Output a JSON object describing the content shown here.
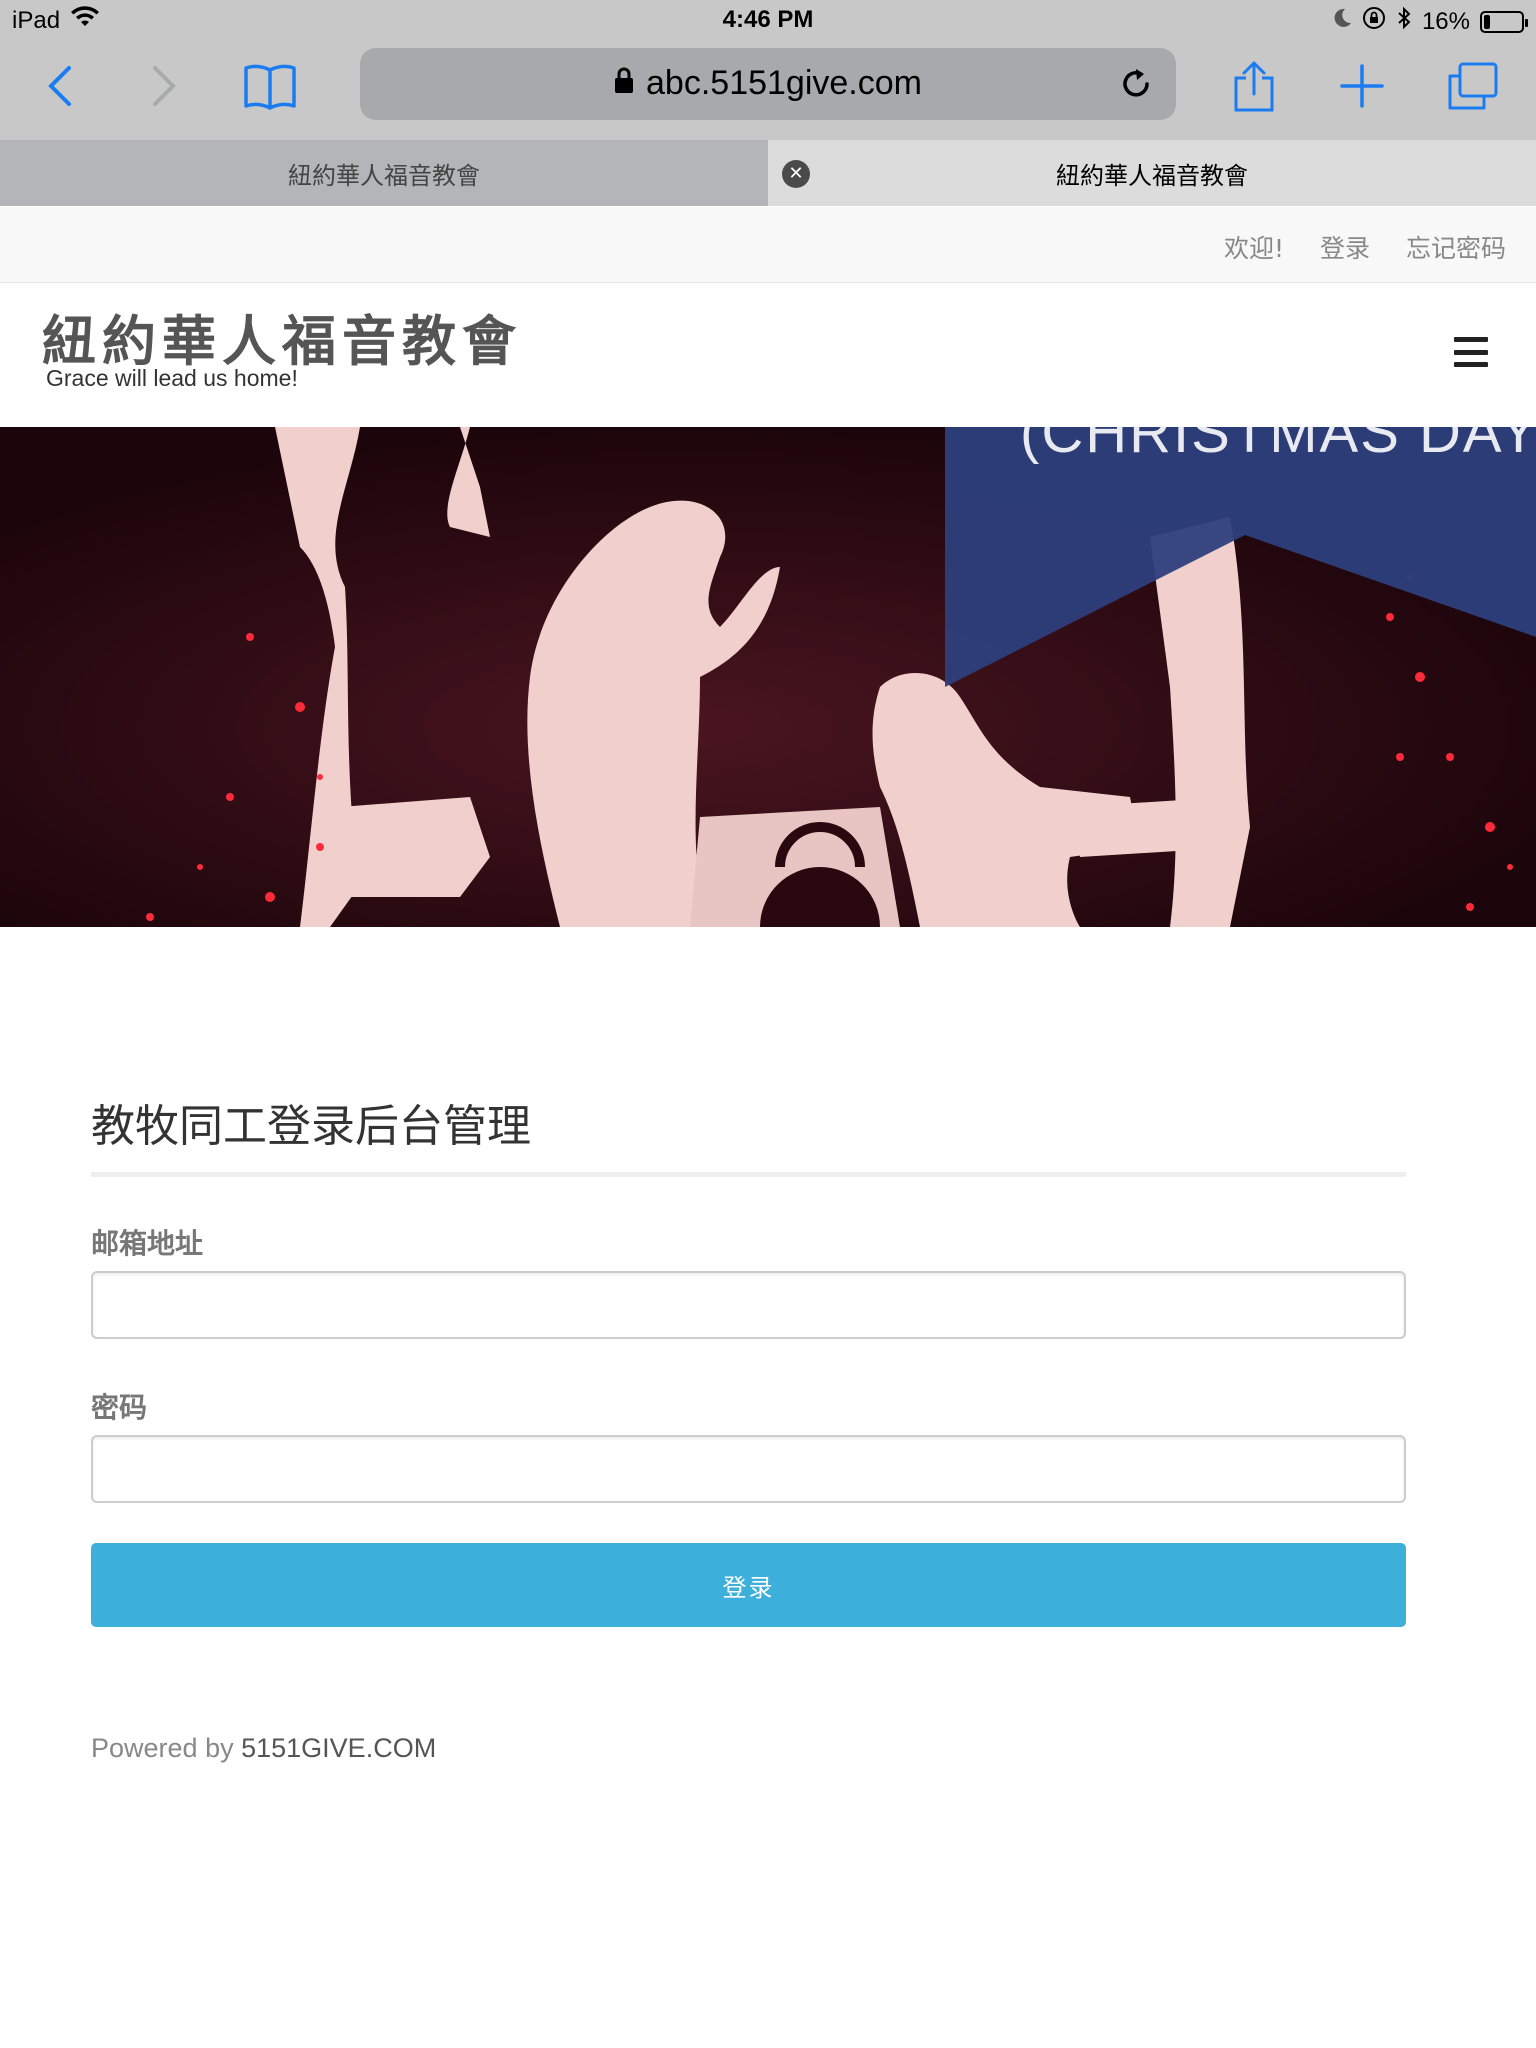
{
  "status_bar": {
    "device": "iPad",
    "time": "4:46 PM",
    "battery_percent": "16%",
    "battery_level": 0.16
  },
  "browser": {
    "url": "abc.5151give.com",
    "tabs": [
      {
        "title": "紐約華人福音教會"
      },
      {
        "title": "紐約華人福音教會"
      }
    ]
  },
  "topbar": {
    "welcome": "欢迎!",
    "login_link": "登录",
    "forgot_link": "忘记密码"
  },
  "header": {
    "site_title": "紐約華人福音教會",
    "tagline": "Grace will lead us home!"
  },
  "hero": {
    "caption": "(CHRISTMAS DAY)"
  },
  "form": {
    "title": "教牧同工登录后台管理",
    "email_label": "邮箱地址",
    "email_value": "",
    "password_label": "密码",
    "password_value": "",
    "submit_label": "登录"
  },
  "footer": {
    "powered_prefix": "Powered by",
    "powered_link": "5151GIVE.COM"
  },
  "colors": {
    "accent": "#3cafda",
    "hero_banner": "#2d3f7c",
    "hero_bg": "#2a0810",
    "figure": "#f0cfcd"
  }
}
